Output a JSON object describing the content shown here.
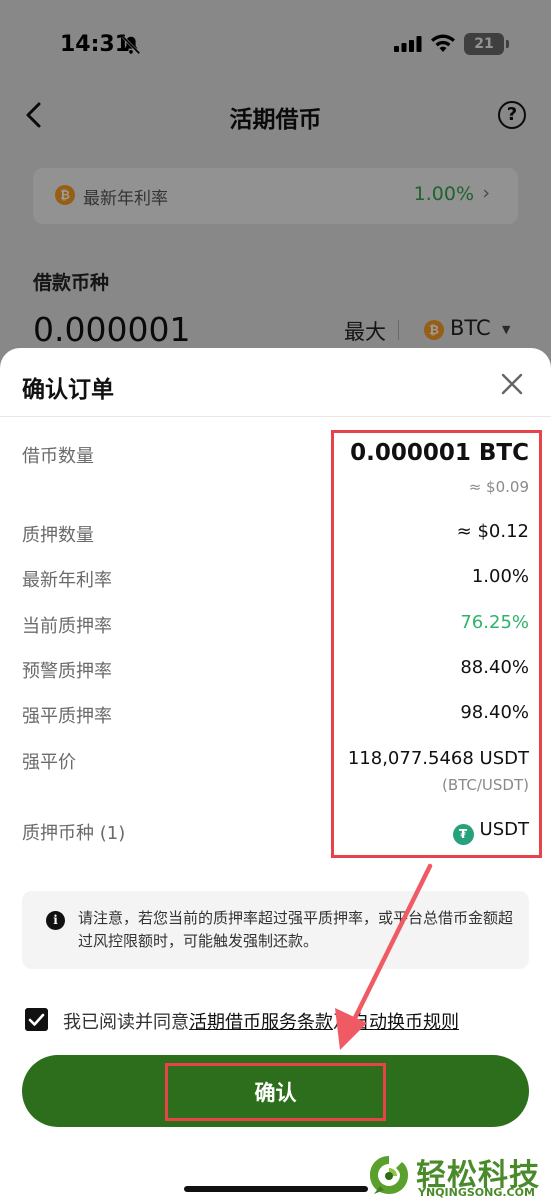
{
  "status_bar": {
    "time": "14:31",
    "battery": "21"
  },
  "nav": {
    "title": "活期借币"
  },
  "rate_card": {
    "label": "最新年利率",
    "value": "1.00%",
    "chevron": "›",
    "coin_icon": "btc-icon"
  },
  "borrow": {
    "label": "借款币种",
    "amount": "0.000001",
    "max_label": "最大",
    "coin": "BTC",
    "coin_glyph": "₿"
  },
  "modal": {
    "title": "确认订单",
    "rows": [
      {
        "label": "借币数量",
        "value": "0.000001 BTC",
        "sub": "≈ $0.09"
      },
      {
        "label": "质押数量",
        "value": "≈ $0.12"
      },
      {
        "label": "最新年利率",
        "value": "1.00%"
      },
      {
        "label": "当前质押率",
        "value": "76.25%"
      },
      {
        "label": "预警质押率",
        "value": "88.40%"
      },
      {
        "label": "强平质押率",
        "value": "98.40%"
      },
      {
        "label": "强平价",
        "value": "118,077.5468 USDT",
        "sub": "(BTC/USDT)"
      },
      {
        "label": "质押币种 (1)",
        "value": "USDT"
      }
    ],
    "notice": "请注意，若您当前的质押率超过强平质押率，或平台总借币金额超过风控限额时，可能触发强制还款。",
    "agree": {
      "prefix": "我已阅读并同意",
      "link1": "活期借币服务条款",
      "conj": "及",
      "link2": "自动换币规则",
      "checked": true
    },
    "confirm_label": "确认"
  },
  "watermark": {
    "text": "轻松科技",
    "sub": "YNQINGSONG.COM"
  },
  "colors": {
    "accent_green": "#2c6e1b",
    "value_green": "#2fb36b",
    "annotation_red": "#e8434b",
    "btc_orange": "#f39a22"
  }
}
